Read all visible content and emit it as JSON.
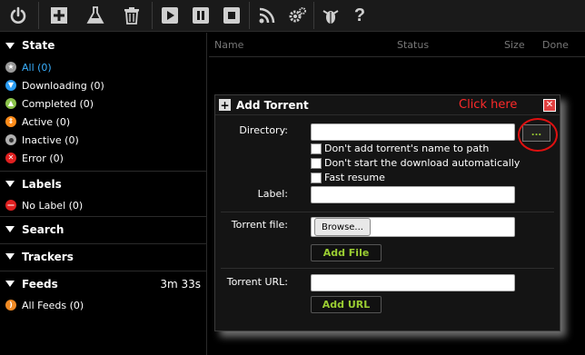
{
  "toolbar": {
    "buttons": [
      {
        "icon": "power-icon"
      },
      {
        "icon": "add-icon"
      },
      {
        "icon": "flask-icon"
      },
      {
        "icon": "trash-icon"
      },
      {
        "icon": "play-icon"
      },
      {
        "icon": "pause-icon"
      },
      {
        "icon": "stop-icon"
      },
      {
        "icon": "rss-icon"
      },
      {
        "icon": "gear-icon"
      },
      {
        "icon": "bug-icon"
      },
      {
        "icon": "help-icon"
      }
    ]
  },
  "sidebar": {
    "state": {
      "title": "State",
      "items": [
        {
          "label": "All",
          "count": "(0)",
          "icon": "star-icon",
          "color": "#9a9a9a"
        },
        {
          "label": "Downloading",
          "count": "(0)",
          "icon": "down-arrow-icon",
          "color": "#2a9df4"
        },
        {
          "label": "Completed",
          "count": "(0)",
          "icon": "up-arrow-icon",
          "color": "#8bc34a"
        },
        {
          "label": "Active",
          "count": "(0)",
          "icon": "updown-icon",
          "color": "#ff8c1a"
        },
        {
          "label": "Inactive",
          "count": "(0)",
          "icon": "circle-icon",
          "color": "#b0b0b0"
        },
        {
          "label": "Error",
          "count": "(0)",
          "icon": "x-icon",
          "color": "#e02020"
        }
      ]
    },
    "labels": {
      "title": "Labels",
      "items": [
        {
          "label": "No Label",
          "count": "(0)",
          "icon": "minus-icon",
          "color": "#e02020"
        }
      ]
    },
    "search": {
      "title": "Search"
    },
    "trackers": {
      "title": "Trackers"
    },
    "feeds": {
      "title": "Feeds",
      "timer": "3m 33s",
      "items": [
        {
          "label": "All Feeds",
          "count": "(0)",
          "icon": "rss-icon",
          "color": "#f08a24"
        }
      ]
    }
  },
  "table": {
    "columns": [
      "Name",
      "Status",
      "Size",
      "Done"
    ]
  },
  "dialog": {
    "title": "Add Torrent",
    "annotation": "Click here",
    "directory_label": "Directory:",
    "directory_value": "",
    "browse_dots": "...",
    "checkbox_1": "Don't add torrent's name to path",
    "checkbox_2": "Don't start the download automatically",
    "checkbox_3": "Fast resume",
    "label_label": "Label:",
    "label_value": "",
    "torrent_file_label": "Torrent file:",
    "browse_label": "Browse...",
    "add_file_label": "Add File",
    "torrent_url_label": "Torrent URL:",
    "torrent_url_value": "",
    "add_url_label": "Add URL"
  }
}
